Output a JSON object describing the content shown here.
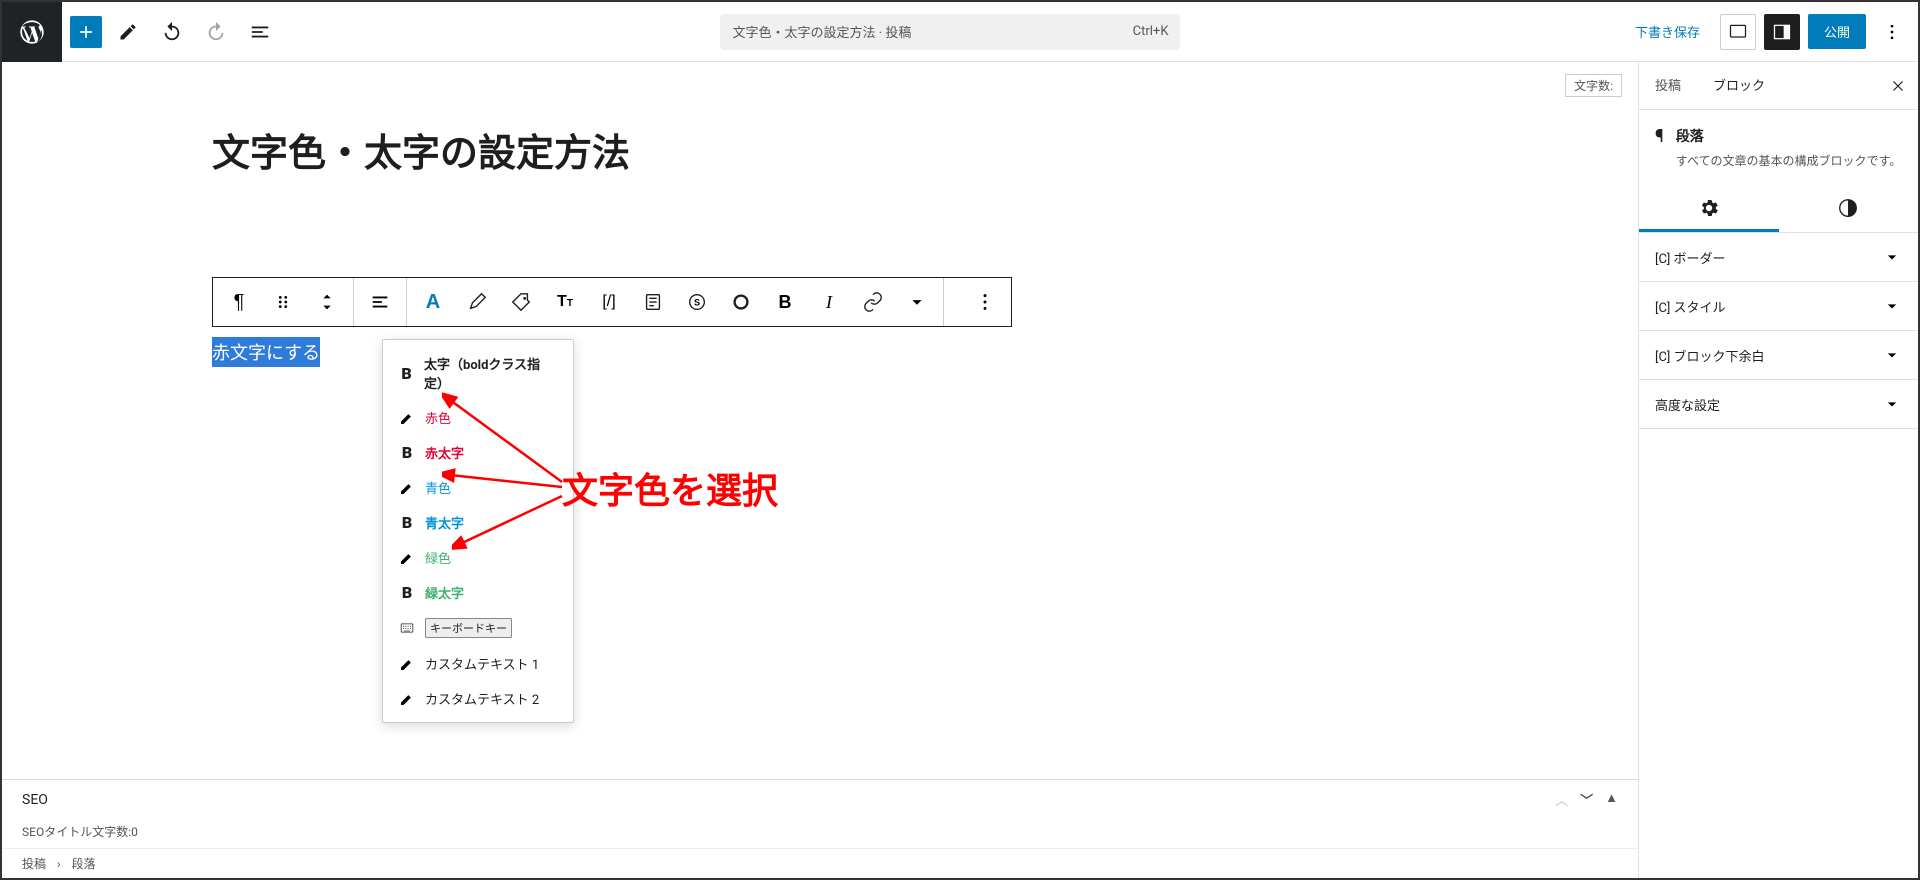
{
  "header": {
    "search_title": "文字色・太字の設定方法 · 投稿",
    "search_shortcut": "Ctrl+K",
    "save_draft": "下書き保存",
    "publish": "公開"
  },
  "editor": {
    "char_count_label": "文字数:",
    "title": "文字色・太字の設定方法",
    "selected_text": "赤文字にする"
  },
  "dropdown": {
    "items": [
      {
        "icon": "bold",
        "label": "太字（boldクラス指定）",
        "class": ""
      },
      {
        "icon": "pen",
        "label": "赤色",
        "class": "c-red"
      },
      {
        "icon": "bold",
        "label": "赤太字",
        "class": "c-red-bold"
      },
      {
        "icon": "pen",
        "label": "青色",
        "class": "c-blue"
      },
      {
        "icon": "bold",
        "label": "青太字",
        "class": "c-blue-bold"
      },
      {
        "icon": "pen",
        "label": "緑色",
        "class": "c-green"
      },
      {
        "icon": "bold",
        "label": "緑太字",
        "class": "c-green-bold"
      },
      {
        "icon": "kbd",
        "label": "キーボードキー",
        "class": "kb-label"
      },
      {
        "icon": "pen",
        "label": "カスタムテキスト 1",
        "class": ""
      },
      {
        "icon": "pen",
        "label": "カスタムテキスト 2",
        "class": ""
      }
    ]
  },
  "annotation": "文字色を選択",
  "seo": {
    "title": "SEO",
    "title_count": "SEOタイトル文字数:0"
  },
  "breadcrumb": {
    "post": "投稿",
    "sep": "›",
    "block": "段落"
  },
  "sidebar": {
    "tab_post": "投稿",
    "tab_block": "ブロック",
    "block_name": "段落",
    "block_desc": "すべての文章の基本の構成ブロックです。",
    "sections": [
      "[C] ボーダー",
      "[C] スタイル",
      "[C] ブロック下余白",
      "高度な設定"
    ]
  }
}
